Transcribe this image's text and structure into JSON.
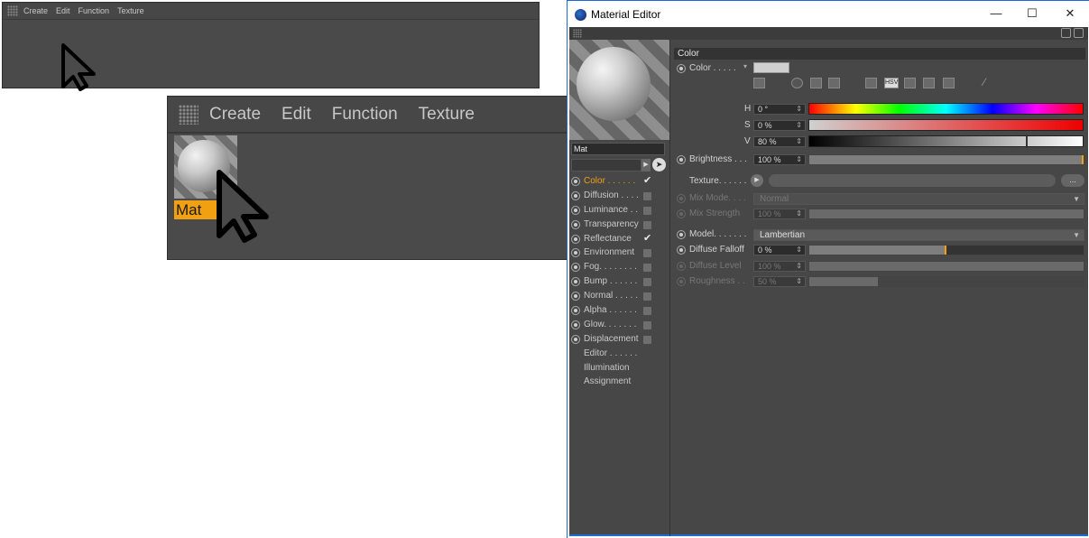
{
  "small_manager": {
    "menu": [
      "Create",
      "Edit",
      "Function",
      "Texture"
    ]
  },
  "zoom_manager": {
    "menu": [
      "Create",
      "Edit",
      "Function",
      "Texture"
    ],
    "material_name": "Mat"
  },
  "editor": {
    "title": "Material Editor",
    "window_controls": {
      "minimize": "—",
      "maximize": "☐",
      "close": "✕"
    },
    "material_name": "Mat",
    "channels": [
      {
        "label": "Color . . . . . .",
        "checked": true,
        "active": true
      },
      {
        "label": "Diffusion . . . .",
        "checked": false
      },
      {
        "label": "Luminance . .",
        "checked": false
      },
      {
        "label": "Transparency",
        "checked": false
      },
      {
        "label": "Reflectance",
        "checked": true
      },
      {
        "label": "Environment",
        "checked": false
      },
      {
        "label": "Fog. . . . . . . .",
        "checked": false
      },
      {
        "label": "Bump . . . . . .",
        "checked": false
      },
      {
        "label": "Normal . . . . .",
        "checked": false
      },
      {
        "label": "Alpha . . . . . .",
        "checked": false
      },
      {
        "label": "Glow. . . . . . .",
        "checked": false
      },
      {
        "label": "Displacement",
        "checked": false
      }
    ],
    "extra_items": [
      "Editor . . . . . .",
      "Illumination",
      "Assignment"
    ],
    "section_title": "Color",
    "color_label": "Color . . . . .",
    "hsv_mode": "HSV",
    "hsv": {
      "h_label": "H",
      "h_value": "0 °",
      "s_label": "S",
      "s_value": "0 %",
      "v_label": "V",
      "v_value": "80 %",
      "v": 0.8
    },
    "brightness": {
      "label": "Brightness . . .",
      "value": "100 %",
      "level": 1.0
    },
    "texture_label": "Texture. . . . . .",
    "texture_more": "...",
    "mix_mode": {
      "label": "Mix Mode. . . .",
      "value": "Normal"
    },
    "mix_strength": {
      "label": "Mix Strength",
      "value": "100 %"
    },
    "model": {
      "label": "Model. . . . . . .",
      "value": "Lambertian"
    },
    "diffuse_falloff": {
      "label": "Diffuse Falloff",
      "value": "0 %",
      "level": 0.5
    },
    "diffuse_level": {
      "label": "Diffuse Level",
      "value": "100 %"
    },
    "roughness": {
      "label": "Roughness . .",
      "value": "50 %",
      "level": 0.25
    },
    "colors": {
      "accent": "#f0a010",
      "panel": "#474747"
    }
  }
}
